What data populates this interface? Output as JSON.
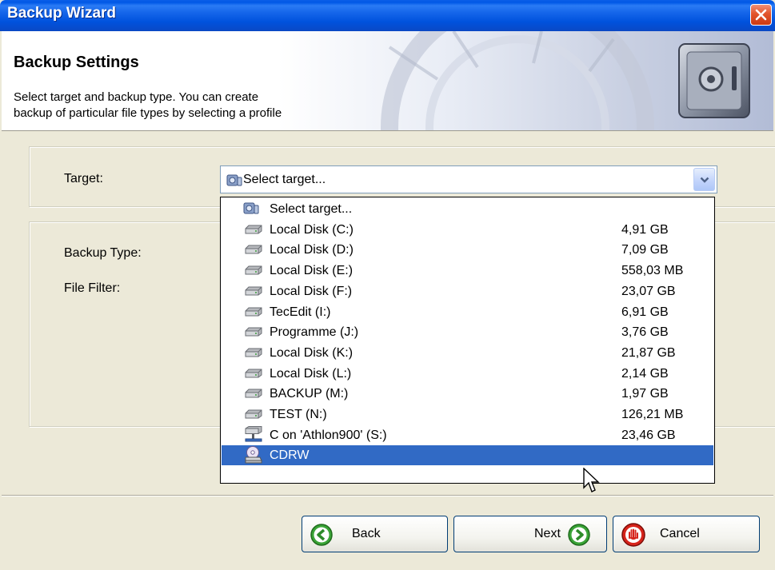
{
  "window": {
    "title": "Backup Wizard"
  },
  "header": {
    "title": "Backup Settings",
    "description": "Select target and backup type. You can create\nbackup of particular file types by selecting a profile"
  },
  "labels": {
    "target": "Target:",
    "backup_type": "Backup Type:",
    "file_filter": "File Filter:"
  },
  "combo": {
    "value": "Select target..."
  },
  "dropdown": {
    "items": [
      {
        "label": "Select target...",
        "size": "",
        "icon": "target-icon"
      },
      {
        "label": "Local Disk (C:)",
        "size": "4,91 GB",
        "icon": "drive-icon"
      },
      {
        "label": "Local Disk (D:)",
        "size": "7,09 GB",
        "icon": "drive-icon"
      },
      {
        "label": "Local Disk (E:)",
        "size": "558,03 MB",
        "icon": "drive-icon"
      },
      {
        "label": "Local Disk (F:)",
        "size": "23,07 GB",
        "icon": "drive-icon"
      },
      {
        "label": "TecEdit (I:)",
        "size": "6,91 GB",
        "icon": "drive-icon"
      },
      {
        "label": "Programme (J:)",
        "size": "3,76 GB",
        "icon": "drive-icon"
      },
      {
        "label": "Local Disk (K:)",
        "size": "21,87 GB",
        "icon": "drive-icon"
      },
      {
        "label": "Local Disk (L:)",
        "size": "2,14 GB",
        "icon": "drive-icon"
      },
      {
        "label": "BACKUP (M:)",
        "size": "1,97 GB",
        "icon": "drive-icon"
      },
      {
        "label": "TEST (N:)",
        "size": "126,21 MB",
        "icon": "drive-icon"
      },
      {
        "label": "C on 'Athlon900' (S:)",
        "size": "23,46 GB",
        "icon": "network-drive-icon"
      },
      {
        "label": "CDRW",
        "size": "",
        "icon": "cd-drive-icon",
        "selected": true
      }
    ]
  },
  "buttons": {
    "back": "Back",
    "next": "Next",
    "cancel": "Cancel"
  },
  "colors": {
    "titlebar": "#0054e3",
    "selection": "#316ac5",
    "face": "#ece9d8"
  }
}
